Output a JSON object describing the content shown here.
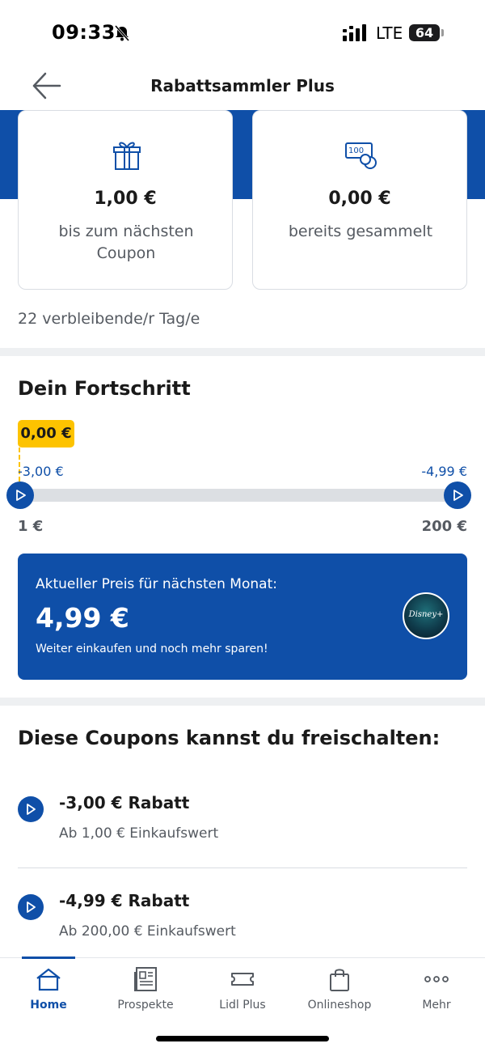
{
  "status_bar": {
    "time": "09:33",
    "network": "LTE",
    "battery": "64"
  },
  "header": {
    "title": "Rabattsammler Plus"
  },
  "stats": {
    "next_coupon": {
      "icon": "gift-icon",
      "value": "1,00 €",
      "label": "bis zum nächsten Coupon"
    },
    "collected": {
      "icon": "coupon-coin-icon",
      "value": "0,00 €",
      "label": "bereits gesammelt"
    }
  },
  "remaining_days": "22 verbleibende/r Tag/e",
  "progress": {
    "title": "Dein Fortschritt",
    "current_badge": "0,00 €",
    "progress_fraction": 0.0,
    "milestone_start": "-3,00 €",
    "milestone_end": "-4,99 €",
    "scale_start": "1 €",
    "scale_end": "200 €"
  },
  "price_card": {
    "label": "Aktueller Preis für nächsten Monat:",
    "value": "4,99 €",
    "subtitle": "Weiter einkaufen und noch mehr sparen!",
    "logo_text": "Disney+"
  },
  "coupons": {
    "title": "Diese Coupons kannst du freischalten:",
    "items": [
      {
        "title": "-3,00 € Rabatt",
        "subtitle": "Ab 1,00 € Einkaufswert"
      },
      {
        "title": "-4,99 € Rabatt",
        "subtitle": "Ab 200,00 € Einkaufswert"
      }
    ]
  },
  "nav": {
    "items": [
      {
        "label": "Home",
        "icon": "home-icon",
        "active": true
      },
      {
        "label": "Prospekte",
        "icon": "newspaper-icon",
        "active": false
      },
      {
        "label": "Lidl Plus",
        "icon": "ticket-icon",
        "active": false
      },
      {
        "label": "Onlineshop",
        "icon": "shopping-bag-icon",
        "active": false
      },
      {
        "label": "Mehr",
        "icon": "more-dots-icon",
        "active": false
      }
    ]
  },
  "colors": {
    "brand_blue": "#0f4fa8",
    "badge_yellow": "#fdc300",
    "track_grey": "#dcdfe3"
  }
}
